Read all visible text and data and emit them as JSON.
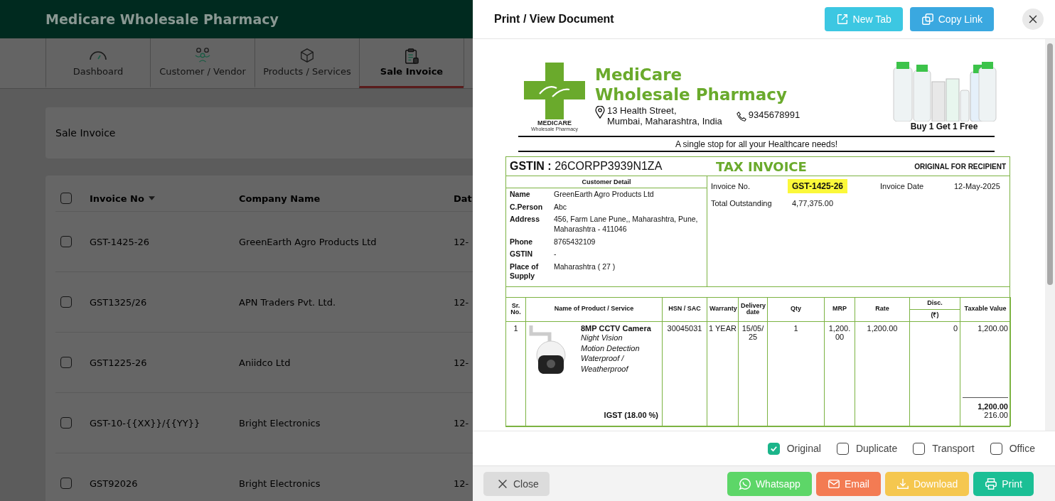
{
  "app": {
    "title": "Medicare Wholesale Pharmacy",
    "tabs": [
      {
        "label": "Dashboard",
        "selected": false
      },
      {
        "label": "Customer / Vendor",
        "selected": false
      },
      {
        "label": "Products / Services",
        "selected": false
      },
      {
        "label": "Sale Invoice",
        "selected": true
      }
    ],
    "section_title": "Sale Invoice",
    "table": {
      "header_checked": false,
      "columns": [
        "Invoice No",
        "Company Name",
        "Dat"
      ],
      "rows": [
        {
          "checked": false,
          "cells": [
            "GST-1425-26",
            "GreenEarth Agro Products Ltd",
            "12-"
          ]
        },
        {
          "checked": false,
          "cells": [
            "GST1325/26",
            "APN Traders Pvt. Ltd.",
            "12-"
          ]
        },
        {
          "checked": false,
          "cells": [
            "GST1225-26",
            "Aniidco Ltd",
            "12-"
          ]
        },
        {
          "checked": false,
          "cells": [
            "GST-10-{{XX}}/{{YY}}",
            "Bright Electronics",
            "12-"
          ]
        },
        {
          "checked": false,
          "cells": [
            "GST92026",
            "Bright Electronics",
            "12-"
          ]
        }
      ]
    }
  },
  "dialog": {
    "title": "Print / View Document",
    "header_buttons": [
      {
        "label": "New Tab",
        "kind": "newtab"
      },
      {
        "label": "Copy Link",
        "kind": "copy"
      }
    ],
    "document": {
      "logo_text": "MEDICARE",
      "logo_subtext": "Wholesale Pharmacy",
      "company_lines": [
        "MediCare",
        "Wholesale Pharmacy"
      ],
      "address_lines": [
        "13 Health Street,",
        "Mumbai, Maharashtra, India"
      ],
      "phone": "9345678991",
      "promo": "Buy 1 Get 1 Free",
      "tagline": "A single stop for all your Healthcare needs!",
      "gstin_label": "GSTIN :",
      "gstin": "26CORPP3939N1ZA",
      "doc_title": "TAX INVOICE",
      "copy_label": "ORIGINAL FOR RECIPIENT",
      "customer_heading": "Customer Detail",
      "customer_fields": [
        {
          "label": "Name",
          "value": "GreenEarth Agro Products Ltd"
        },
        {
          "label": "C.Person",
          "value": "Abc"
        },
        {
          "label": "Address",
          "value": "456, Farm Lane Pune,, Maharashtra, Pune, Maharashtra - 411046"
        },
        {
          "label": "Phone",
          "value": "8765432109"
        },
        {
          "label": "GSTIN",
          "value": "-"
        },
        {
          "label": "Place of Supply",
          "value": "Maharashtra ( 27 )"
        }
      ],
      "invoice_no_label": "Invoice No.",
      "invoice_no": "GST-1425-26",
      "date_label": "Invoice Date",
      "date": "12-May-2025",
      "outstanding_label": "Total Outstanding",
      "outstanding": "4,77,375.00",
      "columns": [
        "Sr. No.",
        "Name of Product / Service",
        "HSN / SAC",
        "Warranty",
        "Delivery date",
        "Qty",
        "MRP",
        "Rate",
        "Disc.",
        "Taxable Value"
      ],
      "disc_unit": "(₹)",
      "items": [
        {
          "sr": "1",
          "name": "8MP CCTV Camera",
          "features": [
            "Night Vision",
            "Motion Detection",
            "Waterproof / Weatherproof"
          ],
          "hsn": "30045031",
          "warranty": "1 YEAR",
          "delivery": "15/05/25",
          "qty": "1",
          "mrp": "1,200.00",
          "rate": "1,200.00",
          "disc": "0",
          "taxable": "1,200.00"
        }
      ],
      "tax_label": "IGST (18.00 %)",
      "subtotal": "1,200.00",
      "tax_amount": "216.00"
    },
    "copies": [
      {
        "label": "Original",
        "checked": true
      },
      {
        "label": "Duplicate",
        "checked": false
      },
      {
        "label": "Transport",
        "checked": false
      },
      {
        "label": "Office",
        "checked": false
      }
    ],
    "footer_buttons": [
      {
        "label": "Close",
        "kind": "close"
      },
      {
        "label": "Whatsapp",
        "kind": "whatsapp"
      },
      {
        "label": "Email",
        "kind": "email"
      },
      {
        "label": "Download",
        "kind": "download"
      },
      {
        "label": "Print",
        "kind": "print"
      }
    ]
  }
}
